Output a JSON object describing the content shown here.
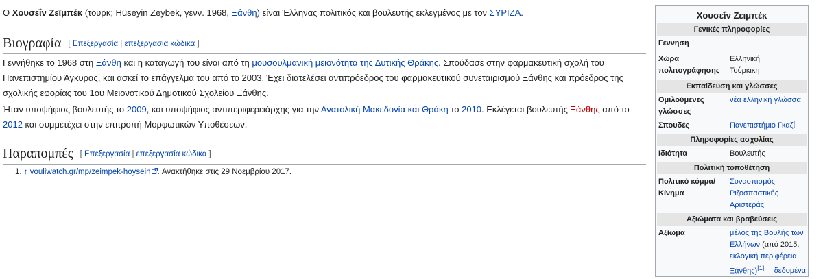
{
  "intro": {
    "o": "Ο ",
    "name_bold": "Χουσεΐν Ζεϊμπέκ",
    "p1": " (τουρκ; Hüseyin Zeybek, γενν. 1968, ",
    "link_xanthi": "Ξάνθη",
    "p2": ") είναι Έλληνας πολιτικός και βουλευτής εκλεγμένος με τον ",
    "link_syriza": "ΣΥΡΙΖΑ",
    "p3": "."
  },
  "bio_heading": {
    "title": "Βιογραφία",
    "open": "[ ",
    "edit": "Επεξεργασία",
    "sep": " | ",
    "edit_code": "επεξεργασία κώδικα",
    "close": " ]"
  },
  "bio_p1": {
    "t1": "Γεννήθηκε το 1968 στη ",
    "link_xanthi": "Ξάνθη",
    "t2": " και η καταγωγή του είναι από τη ",
    "link_minority": "μουσουλμανική μειονότητα της Δυτικής Θράκης",
    "t3": ". Σπούδασε στην φαρμακευτική σχολή του Πανεπιστημίου Άγκυρας, και ασκεί το επάγγελμα του από το 2003. Έχει διατελέσει αντιπρόεδρος του φαρμακευτικού συνεταιρισμού Ξάνθης και πρόεδρος της σχολικής εφορίας του 1ου Μειονοτικού Δημοτικού Σχολείου Ξάνθης."
  },
  "bio_p2": {
    "t1": "Ήταν υποψήφιος βουλευτής το ",
    "link_2009": "2009",
    "t2": ", και υποψήφιος αντιπεριφερειάρχης για την ",
    "link_region": "Ανατολική Μακεδονία και Θράκη",
    "t3": " το ",
    "link_2010": "2010",
    "t4": ". Εκλέγεται βουλευτής ",
    "link_xanthis": "Ξάνθης",
    "t5": " από το ",
    "link_2012": "2012",
    "t6": " και συμμετέχει στην επιτροπή Μορφωτικών Υποθέσεων."
  },
  "ref_heading": {
    "title": "Παραπομπές",
    "open": "[ ",
    "edit": "Επεξεργασία",
    "sep": " | ",
    "edit_code": "επεξεργασία κώδικα",
    "close": " ]"
  },
  "refs": {
    "num": "1. ",
    "arrow": "↑",
    "link": "vouliwatch.gr/mp/zeimpek-hoysein",
    "text": ". Ανακτήθηκε στις 29  Νοεμβρίου 2017."
  },
  "infobox": {
    "title": "Χουσεΐν Ζειμπέκ",
    "h_general": "Γενικές πληροφορίες",
    "birth_label": "Γέννηση",
    "citizenship_label1": "Χώρα",
    "citizenship_label2": "πολιτογράφησης",
    "citizenship_value1": "Ελληνική",
    "citizenship_value2": "Τούρκικη",
    "h_education": "Εκπαίδευση και γλώσσες",
    "languages_label1": "Ομιλούμενες",
    "languages_label2": "γλώσσες",
    "languages_value": "νέα ελληνική γλώσσα",
    "studies_label": "Σπουδές",
    "studies_value": "Πανεπιστήμιο Γκαζί",
    "h_occupation": "Πληροφορίες ασχολίας",
    "occupation_label": "Ιδιότητα",
    "occupation_value": "Βουλευτής",
    "h_political": "Πολιτική τοποθέτηση",
    "party_label1": "Πολιτικό κόμμα/",
    "party_label2": "Κίνημα",
    "party_value1": "Συνασπισμός",
    "party_value2": "Ριζοσπαστικής Αριστεράς",
    "h_awards": "Αξιώματα και βραβεύσεις",
    "office_label": "Αξίωμα",
    "office_v1": "μέλος της Βουλής των",
    "office_v2": "Ελλήνων",
    "office_v3": " (από 2015,",
    "office_v4": "εκλογική περιφέρεια",
    "office_v5": "Ξάνθης)",
    "office_ref": "[1]",
    "more": "δεδομένα"
  }
}
